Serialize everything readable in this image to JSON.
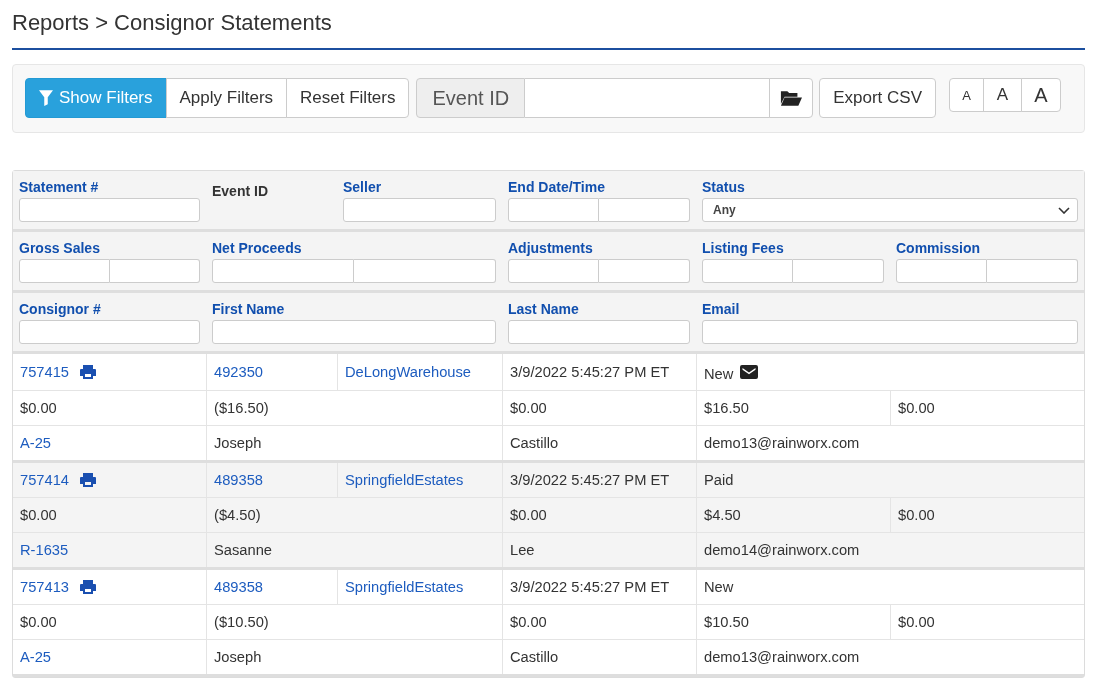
{
  "breadcrumb": "Reports > Consignor Statements",
  "toolbar": {
    "filter_buttons": [
      {
        "label": "Show Filters",
        "kind": "primary"
      },
      {
        "label": "Apply Filters",
        "kind": "default"
      },
      {
        "label": "Reset Filters",
        "kind": "default"
      }
    ],
    "event_id_field": {
      "label": "Event ID"
    },
    "export_button": "Export CSV",
    "text_size_buttons": [
      {
        "label": "A",
        "kind": "small"
      },
      {
        "label": "A",
        "kind": "medium"
      },
      {
        "label": "A",
        "kind": "large"
      }
    ]
  },
  "filter_fields": [
    {
      "label": "Statement #",
      "kind": "text"
    },
    {
      "label": "Event ID",
      "kind": "none"
    },
    {
      "label": "Seller",
      "kind": "text"
    },
    {
      "label": "End Date/Time",
      "kind": "range"
    },
    {
      "label": "Status",
      "kind": "select",
      "value": "Any"
    },
    {
      "label": "Gross Sales",
      "kind": "range"
    },
    {
      "label": "Net Proceeds",
      "kind": "range"
    },
    {
      "label": "Adjustments",
      "kind": "range"
    },
    {
      "label": "Listing Fees",
      "kind": "range"
    },
    {
      "label": "Commission",
      "kind": "range"
    },
    {
      "label": "Consignor #",
      "kind": "text"
    },
    {
      "label": "First Name",
      "kind": "text"
    },
    {
      "label": "Last Name",
      "kind": "text"
    },
    {
      "label": "Email",
      "kind": "text"
    }
  ],
  "statements": [
    {
      "statement_no": "757415",
      "event_id": "492350",
      "seller": "DeLongWarehouse",
      "end_date": "3/9/2022 5:45:27 PM ET",
      "status": "New",
      "emailed": true,
      "gross_sales": "$0.00",
      "net_proceeds": "($16.50)",
      "adjustments": "$0.00",
      "listing_fees": "$16.50",
      "commission": "$0.00",
      "consignor_no": "A-25",
      "first_name": "Joseph",
      "last_name": "Castillo",
      "email": "demo13@rainworx.com"
    },
    {
      "statement_no": "757414",
      "event_id": "489358",
      "seller": "SpringfieldEstates",
      "end_date": "3/9/2022 5:45:27 PM ET",
      "status": "Paid",
      "emailed": false,
      "gross_sales": "$0.00",
      "net_proceeds": "($4.50)",
      "adjustments": "$0.00",
      "listing_fees": "$4.50",
      "commission": "$0.00",
      "consignor_no": "R-1635",
      "first_name": "Sasanne",
      "last_name": "Lee",
      "email": "demo14@rainworx.com"
    },
    {
      "statement_no": "757413",
      "event_id": "489358",
      "seller": "SpringfieldEstates",
      "end_date": "3/9/2022 5:45:27 PM ET",
      "status": "New",
      "emailed": false,
      "gross_sales": "$0.00",
      "net_proceeds": "($10.50)",
      "adjustments": "$0.00",
      "listing_fees": "$10.50",
      "commission": "$0.00",
      "consignor_no": "A-25",
      "first_name": "Joseph",
      "last_name": "Castillo",
      "email": "demo13@rainworx.com"
    }
  ]
}
